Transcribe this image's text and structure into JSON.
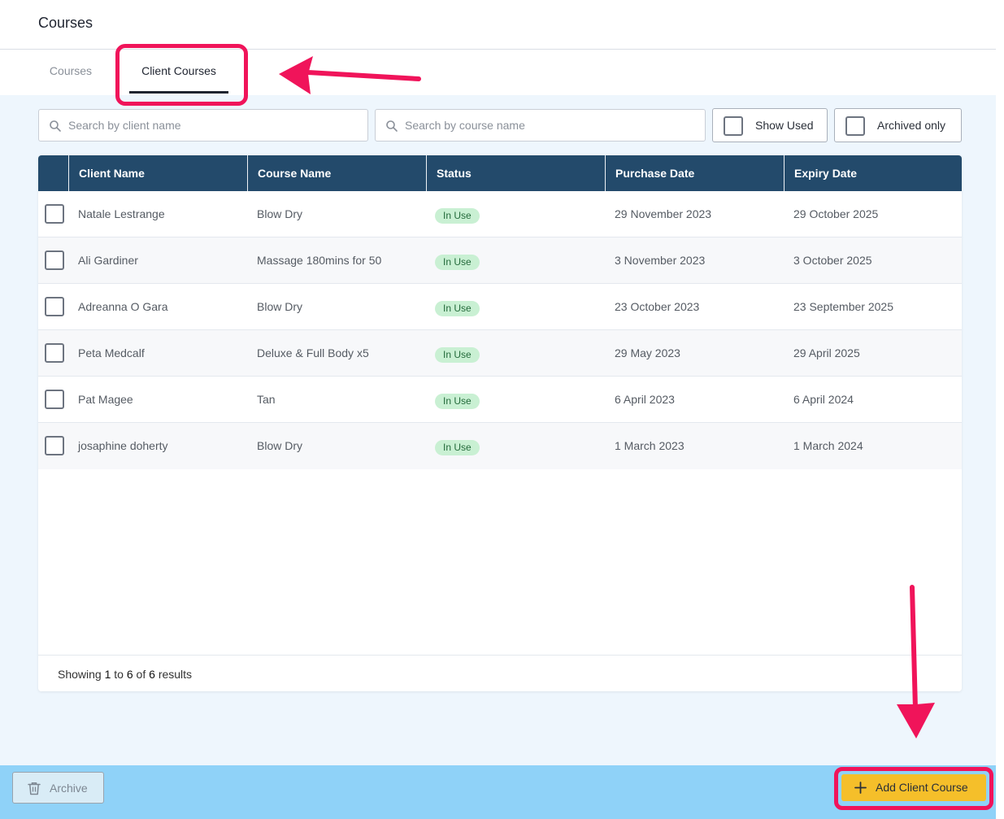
{
  "header": {
    "title": "Courses"
  },
  "tabs": [
    {
      "label": "Courses",
      "active": false
    },
    {
      "label": "Client Courses",
      "active": true
    }
  ],
  "filters": {
    "client_search_placeholder": "Search by client name",
    "course_search_placeholder": "Search by course name",
    "show_used_label": "Show Used",
    "archived_only_label": "Archived only"
  },
  "table": {
    "columns": [
      "Client Name",
      "Course Name",
      "Status",
      "Purchase Date",
      "Expiry Date"
    ],
    "rows": [
      {
        "client": "Natale Lestrange",
        "course": "Blow Dry",
        "status": "In Use",
        "purchase": "29 November 2023",
        "expiry": "29 October 2025"
      },
      {
        "client": "Ali Gardiner",
        "course": "Massage 180mins for 50",
        "status": "In Use",
        "purchase": "3 November 2023",
        "expiry": "3 October 2025"
      },
      {
        "client": "Adreanna O Gara",
        "course": "Blow Dry",
        "status": "In Use",
        "purchase": "23 October 2023",
        "expiry": "23 September 2025"
      },
      {
        "client": "Peta Medcalf",
        "course": "Deluxe & Full Body x5",
        "status": "In Use",
        "purchase": "29 May 2023",
        "expiry": "29 April 2025"
      },
      {
        "client": "Pat Magee",
        "course": "Tan",
        "status": "In Use",
        "purchase": "6 April 2023",
        "expiry": "6 April 2024"
      },
      {
        "client": "josaphine doherty",
        "course": "Blow Dry",
        "status": "In Use",
        "purchase": "1 March 2023",
        "expiry": "1 March 2024"
      }
    ]
  },
  "pagination": {
    "prefix": "Showing",
    "from": "1",
    "to_word": "to",
    "to": "6",
    "of_word": "of",
    "total": "6",
    "suffix": "results"
  },
  "actions": {
    "archive_label": "Archive",
    "add_label": "Add Client Course"
  },
  "icons": {
    "search": "search-icon",
    "trash": "trash-icon",
    "plus": "plus-icon"
  },
  "colors": {
    "header_bg": "#234a6b",
    "content_bg": "#eef6fd",
    "bottom_bar": "#8fd2f8",
    "add_button": "#f5bf2a",
    "badge_bg": "#c9f0d3",
    "annotation": "#f0145a"
  }
}
